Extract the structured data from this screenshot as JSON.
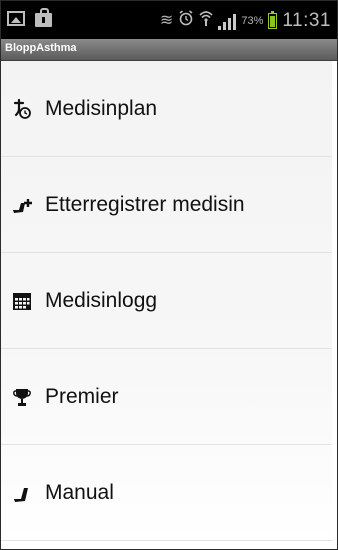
{
  "status_bar": {
    "icons": [
      "image-icon",
      "bag-icon",
      "muted-sync-icon",
      "alarm-icon",
      "wifi-icon",
      "signal-icon",
      "battery-icon"
    ],
    "battery_percent": "73%",
    "time": "11:31"
  },
  "app": {
    "title": "BloppAsthma"
  },
  "menu": {
    "items": [
      {
        "label": "Medisinplan",
        "icon": "pill-timer-icon"
      },
      {
        "label": "Etterregistrer medisin",
        "icon": "inhaler-plus-icon"
      },
      {
        "label": "Medisinlogg",
        "icon": "calendar-icon"
      },
      {
        "label": "Premier",
        "icon": "trophy-icon"
      },
      {
        "label": "Manual",
        "icon": "inhaler-icon"
      }
    ]
  },
  "colors": {
    "status_bar_bg": "#000000",
    "title_bar_bg": "#6e6e6e",
    "battery_green": "#8bc41f"
  }
}
